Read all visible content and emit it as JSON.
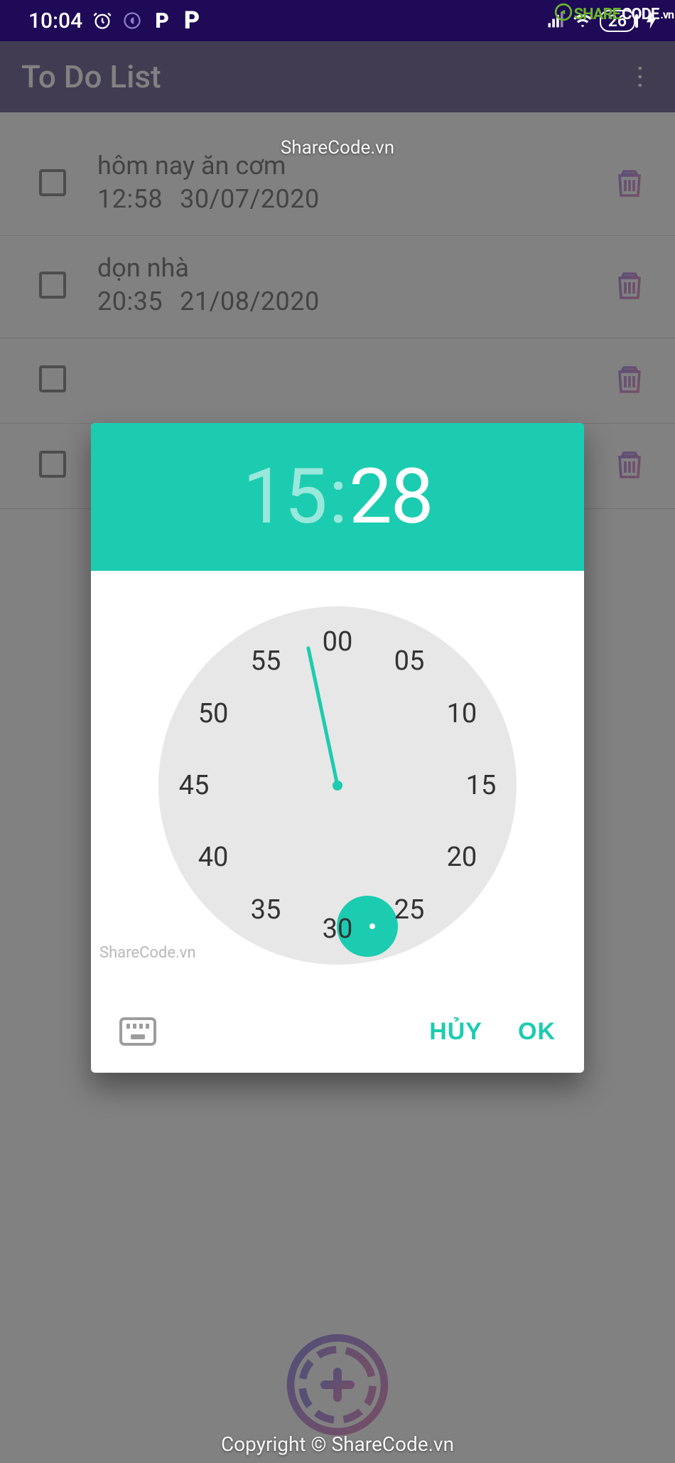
{
  "statusbar": {
    "time": "10:04",
    "battery": "26"
  },
  "appbar": {
    "title": "To Do List"
  },
  "watermarks": {
    "top": "ShareCode.vn",
    "mid": "ShareCode.vn",
    "bottom": "Copyright © ShareCode.vn",
    "logo1": "SHARE",
    "logo2": "CODE",
    "logo3": ".vn"
  },
  "todos": [
    {
      "title": "hôm nay ăn cơm",
      "time": "12:58",
      "date": "30/07/2020"
    },
    {
      "title": "dọn nhà",
      "time": "20:35",
      "date": "21/08/2020"
    },
    {
      "title": "",
      "time": "",
      "date": ""
    },
    {
      "title": "",
      "time": "",
      "date": ""
    }
  ],
  "timepicker": {
    "hour": "15",
    "minute": "28",
    "selected_minute": 28,
    "ticks": [
      "00",
      "05",
      "10",
      "15",
      "20",
      "25",
      "30",
      "35",
      "40",
      "45",
      "50",
      "55"
    ],
    "cancel": "HỦY",
    "ok": "OK"
  },
  "colors": {
    "accent": "#1cccb0",
    "statusbg": "#1e0a57"
  }
}
